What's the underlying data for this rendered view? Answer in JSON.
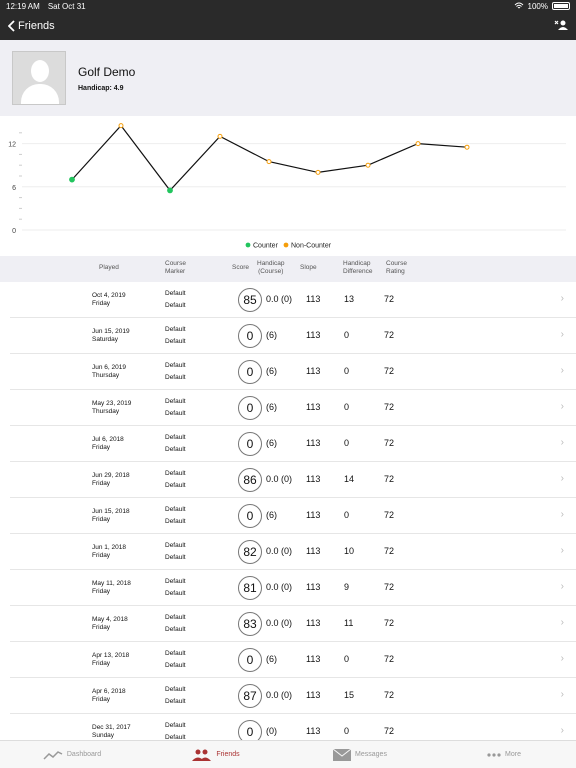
{
  "status": {
    "time": "12:19 AM",
    "date": "Sat Oct 31",
    "battery": "100%"
  },
  "nav": {
    "back_label": "Friends"
  },
  "profile": {
    "name": "Golf Demo",
    "handicap": "Handicap: 4.9"
  },
  "chart_data": {
    "type": "line",
    "x": [
      1,
      2,
      3,
      4,
      5,
      6,
      7,
      8,
      9
    ],
    "y": [
      7,
      14.5,
      5.5,
      13,
      9.5,
      8,
      9,
      12,
      11.5
    ],
    "point_kind": [
      "Counter",
      "Non-Counter",
      "Counter",
      "Non-Counter",
      "Non-Counter",
      "Non-Counter",
      "Non-Counter",
      "Non-Counter",
      "Non-Counter"
    ],
    "yticks": [
      "12",
      "6",
      "0"
    ],
    "ylim": [
      0,
      15
    ],
    "legend": [
      "Counter",
      "Non-Counter"
    ],
    "colors": {
      "Counter": "#22c55e",
      "Non-Counter": "#f59e0b"
    },
    "grid": true
  },
  "table": {
    "headers": {
      "played": "Played",
      "marker": "Course\nMarker",
      "score": "Score",
      "handicap": "Handicap\n(Course)",
      "slope": "Slope",
      "diff": "Handicap\nDifference",
      "rating": "Course\nRating"
    },
    "rows": [
      {
        "date": "Oct 4, 2019",
        "day": "Friday",
        "m1": "Default",
        "m2": "Default",
        "score": "85",
        "hc": "0.0 (0)",
        "slope": "113",
        "diff": "13",
        "rating": "72"
      },
      {
        "date": "Jun 15, 2019",
        "day": "Saturday",
        "m1": "Default",
        "m2": "Default",
        "score": "0",
        "hc": "(6)",
        "slope": "113",
        "diff": "0",
        "rating": "72"
      },
      {
        "date": "Jun 6, 2019",
        "day": "Thursday",
        "m1": "Default",
        "m2": "Default",
        "score": "0",
        "hc": "(6)",
        "slope": "113",
        "diff": "0",
        "rating": "72"
      },
      {
        "date": "May 23, 2019",
        "day": "Thursday",
        "m1": "Default",
        "m2": "Default",
        "score": "0",
        "hc": "(6)",
        "slope": "113",
        "diff": "0",
        "rating": "72"
      },
      {
        "date": "Jul 6, 2018",
        "day": "Friday",
        "m1": "Default",
        "m2": "Default",
        "score": "0",
        "hc": "(6)",
        "slope": "113",
        "diff": "0",
        "rating": "72"
      },
      {
        "date": "Jun 29, 2018",
        "day": "Friday",
        "m1": "Default",
        "m2": "Default",
        "score": "86",
        "hc": "0.0 (0)",
        "slope": "113",
        "diff": "14",
        "rating": "72"
      },
      {
        "date": "Jun 15, 2018",
        "day": "Friday",
        "m1": "Default",
        "m2": "Default",
        "score": "0",
        "hc": "(6)",
        "slope": "113",
        "diff": "0",
        "rating": "72"
      },
      {
        "date": "Jun 1, 2018",
        "day": "Friday",
        "m1": "Default",
        "m2": "Default",
        "score": "82",
        "hc": "0.0 (0)",
        "slope": "113",
        "diff": "10",
        "rating": "72"
      },
      {
        "date": "May 11, 2018",
        "day": "Friday",
        "m1": "Default",
        "m2": "Default",
        "score": "81",
        "hc": "0.0 (0)",
        "slope": "113",
        "diff": "9",
        "rating": "72"
      },
      {
        "date": "May 4, 2018",
        "day": "Friday",
        "m1": "Default",
        "m2": "Default",
        "score": "83",
        "hc": "0.0 (0)",
        "slope": "113",
        "diff": "11",
        "rating": "72"
      },
      {
        "date": "Apr 13, 2018",
        "day": "Friday",
        "m1": "Default",
        "m2": "Default",
        "score": "0",
        "hc": "(6)",
        "slope": "113",
        "diff": "0",
        "rating": "72"
      },
      {
        "date": "Apr 6, 2018",
        "day": "Friday",
        "m1": "Default",
        "m2": "Default",
        "score": "87",
        "hc": "0.0 (0)",
        "slope": "113",
        "diff": "15",
        "rating": "72"
      },
      {
        "date": "Dec 31, 2017",
        "day": "Sunday",
        "m1": "Default",
        "m2": "Default",
        "score": "0",
        "hc": "(0)",
        "slope": "113",
        "diff": "0",
        "rating": "72"
      }
    ]
  },
  "tabs": [
    {
      "label": "Dashboard",
      "icon": "chart-line-icon"
    },
    {
      "label": "Friends",
      "icon": "people-icon"
    },
    {
      "label": "Messages",
      "icon": "envelope-icon"
    },
    {
      "label": "More",
      "icon": "dots-icon"
    }
  ]
}
